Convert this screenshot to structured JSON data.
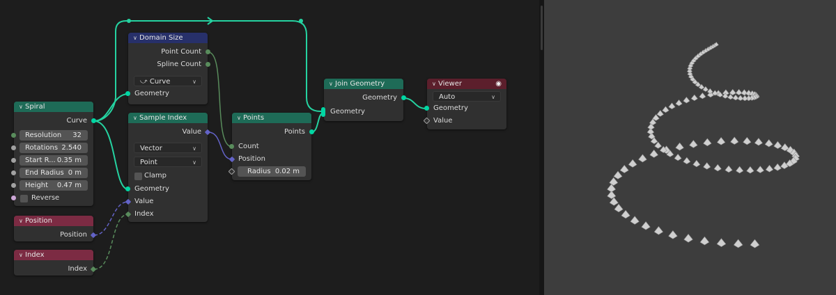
{
  "editor": {
    "nodes": {
      "domain_size": {
        "title": "Domain Size",
        "outputs": [
          "Point Count",
          "Spline Count"
        ],
        "component": "Curve",
        "input": "Geometry"
      },
      "spiral": {
        "title": "Spiral",
        "output": "Curve",
        "fields": [
          {
            "label": "Resolution",
            "value": "32"
          },
          {
            "label": "Rotations",
            "value": "2.540"
          },
          {
            "label": "Start R...",
            "value": "0.35 m"
          },
          {
            "label": "End Radius",
            "value": "0 m"
          },
          {
            "label": "Height",
            "value": "0.47 m"
          }
        ],
        "reverse": "Reverse"
      },
      "sample_index": {
        "title": "Sample Index",
        "output": "Value",
        "data_type": "Vector",
        "domain": "Point",
        "clamp": "Clamp",
        "inputs": [
          "Geometry",
          "Value",
          "Index"
        ]
      },
      "points": {
        "title": "Points",
        "output": "Points",
        "inputs": [
          "Count",
          "Position"
        ],
        "radius": {
          "label": "Radius",
          "value": "0.02 m"
        }
      },
      "join_geometry": {
        "title": "Join Geometry",
        "output": "Geometry",
        "input": "Geometry"
      },
      "viewer": {
        "title": "Viewer",
        "mode": "Auto",
        "inputs": [
          "Geometry",
          "Value"
        ],
        "icon": "eye-icon"
      },
      "position": {
        "title": "Position",
        "output": "Position"
      },
      "index": {
        "title": "Index",
        "output": "Index"
      }
    }
  },
  "colors": {
    "geometry_header": "#1e6b57",
    "field_header": "#27306a",
    "input_header": "#7c2b43",
    "output_header": "#5c1f2c",
    "geometry_socket": "#00d6a3",
    "vector_socket": "#6363c7",
    "integer_socket": "#598c5c",
    "float_socket": "#a1a1a1",
    "viewport_bg": "#3d3d3d"
  }
}
